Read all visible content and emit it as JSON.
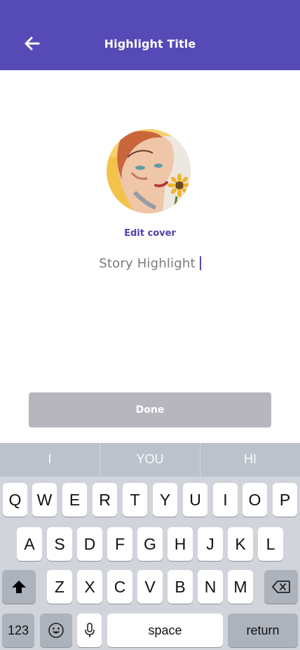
{
  "theme": {
    "accent": "#554ab6",
    "accent_text": "#4c43a8",
    "done_disabled": "#b7b6bf"
  },
  "header": {
    "title": "Highlight Title",
    "back_icon": "arrow-left-icon"
  },
  "cover": {
    "image": "portrait-painting-with-sunflower",
    "edit_label": "Edit cover"
  },
  "title_field": {
    "value": "Story Highlight"
  },
  "done_button": {
    "label": "Done",
    "enabled": false
  },
  "keyboard": {
    "suggestions": [
      "I",
      "YOU",
      "HI"
    ],
    "row1": [
      "Q",
      "W",
      "E",
      "R",
      "T",
      "Y",
      "U",
      "I",
      "O",
      "P"
    ],
    "row2": [
      "A",
      "S",
      "D",
      "F",
      "G",
      "H",
      "J",
      "K",
      "L"
    ],
    "row3": [
      "Z",
      "X",
      "C",
      "V",
      "B",
      "N",
      "M"
    ],
    "shift_icon": "shift-arrow-icon",
    "delete_icon": "backspace-icon",
    "numbers_label": "123",
    "emoji_icon": "emoji-icon",
    "mic_icon": "microphone-icon",
    "space_label": "space",
    "return_label": "return"
  }
}
